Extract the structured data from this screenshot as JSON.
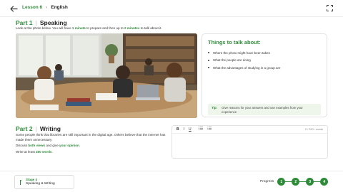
{
  "header": {
    "lesson": "Lesson 6",
    "subject": "English",
    "back_icon": "arrow-left-icon",
    "expand_icon": "fullscreen-icon"
  },
  "part1": {
    "num": "Part 1",
    "name": "Speaking",
    "instr_a": "Look at the photo below. You will have ",
    "instr_b": "1 minute",
    "instr_c": " to prepare and then up to ",
    "instr_d": "2 minutes",
    "instr_e": " to talk about it."
  },
  "talk": {
    "title": "Things to talk about:",
    "items": [
      "Where the photo might have been taken",
      "What the people are doing",
      "What the advantages of studying in a group are"
    ],
    "tip_label": "Tip:",
    "tip_text": "Give reasons for your answers and use examples from your experience"
  },
  "part2": {
    "num": "Part 2",
    "name": "Writing",
    "p1": "Some people think that libraries are still important in the digital age. Others believe that the internet has made them unnecessary.",
    "p2a": "Discuss ",
    "p2b": "both views",
    "p2c": " and give ",
    "p2d": "your opinion",
    "p2e": ".",
    "p3a": "Write at least ",
    "p3b": "250 words",
    "p3c": "."
  },
  "editor": {
    "bold": "B",
    "italic": "I",
    "underline": "U",
    "bullet_icon": "bulleted-list-icon",
    "number_icon": "numbered-list-icon",
    "count": "0 / 250+ words"
  },
  "footer": {
    "stage_label": "Stage 4",
    "stage_name": "Speaking & Writing",
    "progress_label": "Progress",
    "steps": [
      "1",
      "2",
      "3",
      "4"
    ]
  },
  "colors": {
    "accent": "#2e8b3a",
    "tip_bg": "#eef6ec"
  }
}
